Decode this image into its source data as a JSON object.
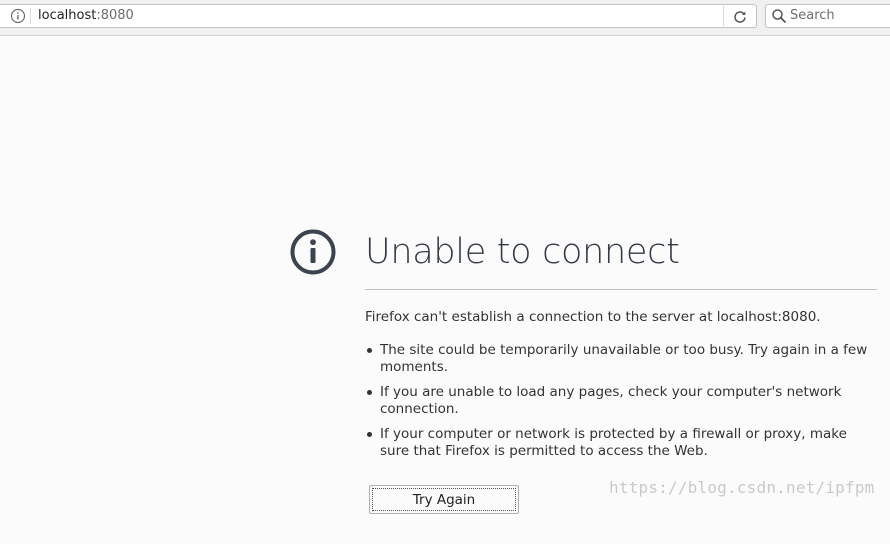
{
  "toolbar": {
    "url_host": "localhost",
    "url_port": ":8080",
    "search_placeholder": "Search",
    "icons": {
      "site_info": "info-circle-icon",
      "reload": "reload-icon",
      "search": "search-icon"
    }
  },
  "error_page": {
    "icon": "info-circle-icon",
    "title": "Unable to connect",
    "description": "Firefox can't establish a connection to the server at localhost:8080.",
    "reasons": [
      "The site could be temporarily unavailable or too busy. Try again in a few moments.",
      "If you are unable to load any pages, check your computer's network connection.",
      "If your computer or network is protected by a firewall or proxy, make sure that Firefox is permitted to access the Web."
    ],
    "try_again_label": "Try Again"
  },
  "watermark": "https://blog.csdn.net/ipfpm",
  "colors": {
    "page_background": "#fbfbfb",
    "title_color": "#333a44",
    "icon_color": "#3c4450"
  }
}
